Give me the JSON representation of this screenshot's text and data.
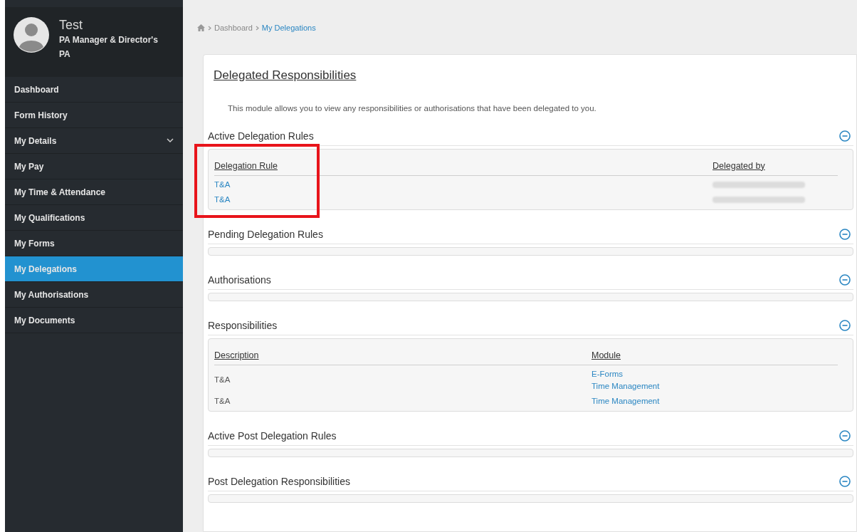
{
  "sidebar": {
    "user": {
      "name": "Test",
      "role": "PA Manager & Director's PA"
    },
    "items": [
      {
        "label": "Dashboard",
        "selected": false,
        "kind": "link"
      },
      {
        "label": "Form History",
        "selected": false,
        "kind": "link"
      },
      {
        "label": "My Details",
        "selected": false,
        "kind": "submenu"
      },
      {
        "label": "My Pay",
        "selected": false,
        "kind": "link"
      },
      {
        "label": "My Time & Attendance",
        "selected": false,
        "kind": "link"
      },
      {
        "label": "My Qualifications",
        "selected": false,
        "kind": "link"
      },
      {
        "label": "My Forms",
        "selected": false,
        "kind": "link"
      },
      {
        "label": "My Delegations",
        "selected": true,
        "kind": "link"
      },
      {
        "label": "My Authorisations",
        "selected": false,
        "kind": "link"
      },
      {
        "label": "My Documents",
        "selected": false,
        "kind": "link"
      }
    ]
  },
  "breadcrumb": [
    {
      "label": "Dashboard",
      "selected": false
    },
    {
      "label": "My Delegations",
      "selected": true
    }
  ],
  "page": {
    "title": "Delegated Responsibilities",
    "description": "This module allows you to view any responsibilities or authorisations that have been delegated to you."
  },
  "sections": [
    {
      "title": "Active Delegation Rules",
      "expanded": true,
      "table": {
        "columns": [
          {
            "label": "Delegation Rule",
            "highlighted": true
          },
          {
            "label": "Delegated by",
            "highlighted": false
          }
        ],
        "rows": [
          [
            {
              "kind": "link",
              "lines": [
                "T&A"
              ]
            },
            {
              "kind": "redacted"
            }
          ],
          [
            {
              "kind": "link",
              "lines": [
                "T&A"
              ]
            },
            {
              "kind": "redacted"
            }
          ]
        ]
      }
    },
    {
      "title": "Pending Delegation Rules",
      "expanded": true
    },
    {
      "title": "Authorisations",
      "expanded": true
    },
    {
      "title": "Responsibilities",
      "expanded": true,
      "table": {
        "columns": [
          {
            "label": "Description",
            "highlighted": false
          },
          {
            "label": "Module",
            "highlighted": false
          }
        ],
        "rows": [
          [
            {
              "kind": "text",
              "lines": [
                "T&A"
              ]
            },
            {
              "kind": "link",
              "lines": [
                "E-Forms",
                "Time Management"
              ]
            }
          ],
          [
            {
              "kind": "text",
              "lines": [
                "T&A"
              ]
            },
            {
              "kind": "link",
              "lines": [
                "Time Management"
              ]
            }
          ]
        ]
      }
    },
    {
      "title": "Active Post Delegation Rules",
      "expanded": true
    },
    {
      "title": "Post Delegation Responsibilities",
      "expanded": true
    }
  ]
}
